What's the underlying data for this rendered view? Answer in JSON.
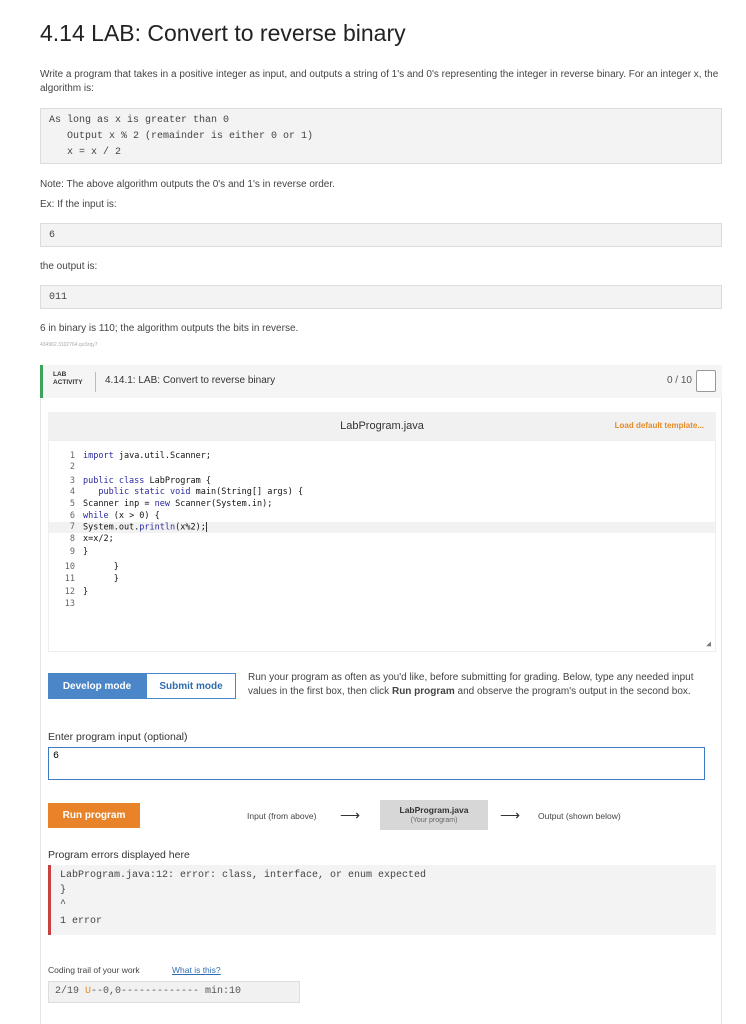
{
  "page": {
    "title": "4.14 LAB: Convert to reverse binary",
    "intro": "Write a program that takes in a positive integer as input, and outputs a string of 1's and 0's representing the integer in reverse binary. For an integer x, the algorithm is:",
    "algorithm": [
      "As long as x is greater than 0",
      "   Output x % 2 (remainder is either 0 or 1)",
      "   x = x / 2"
    ],
    "note": "Note: The above algorithm outputs the 0's and 1's in reverse order.",
    "ex_label": "Ex: If the input is:",
    "ex_input": "6",
    "output_label": "the output is:",
    "ex_output": "011",
    "explanation": "6 in binary is 110; the algorithm outputs the bits in reverse.",
    "tiny_id": "434962.3102764.qx3zqy7"
  },
  "lab": {
    "tag_line1": "LAB",
    "tag_line2": "ACTIVITY",
    "title": "4.14.1: LAB: Convert to reverse binary",
    "score": "0 / 10"
  },
  "editor": {
    "filename": "LabProgram.java",
    "load_template": "Load default template...",
    "lines": [
      {
        "n": "1",
        "t": "import java.util.Scanner;"
      },
      {
        "n": "2",
        "t": ""
      },
      {
        "n": "3",
        "t": "public class LabProgram {"
      },
      {
        "n": "4",
        "t": "   public static void main(String[] args) {"
      },
      {
        "n": "5",
        "t": "Scanner inp = new Scanner(System.in);"
      },
      {
        "n": "6",
        "t": "while (x > 0) {"
      },
      {
        "n": "7",
        "t": "System.out.println(x%2);"
      },
      {
        "n": "8",
        "t": "x=x/2;"
      },
      {
        "n": "9",
        "t": "}"
      },
      {
        "n": "10",
        "t": "      }"
      },
      {
        "n": "11",
        "t": "      }"
      },
      {
        "n": "12",
        "t": "}"
      },
      {
        "n": "13",
        "t": ""
      }
    ]
  },
  "modes": {
    "develop": "Develop mode",
    "submit": "Submit mode"
  },
  "run_desc_pre": "Run your program as often as you'd like, before submitting for grading. Below, type any needed input values in the first box, then click ",
  "run_desc_bold": "Run program",
  "run_desc_post": " and observe the program's output in the second box.",
  "input": {
    "label": "Enter program input (optional)",
    "value": "6"
  },
  "run": {
    "button": "Run program",
    "input_from": "Input (from above)",
    "prog_name": "LabProgram.java",
    "prog_sub": "(Your program)",
    "output_to": "Output (shown below)"
  },
  "errors": {
    "label": "Program errors displayed here",
    "lines": [
      "LabProgram.java:12: error: class, interface, or enum expected",
      "}",
      "^",
      "1 error"
    ]
  },
  "trail": {
    "label": "Coding trail of your work",
    "link": "What is this?",
    "prefix": "2/19 ",
    "u": "U",
    "rest": "--0,0------------- min:10"
  }
}
